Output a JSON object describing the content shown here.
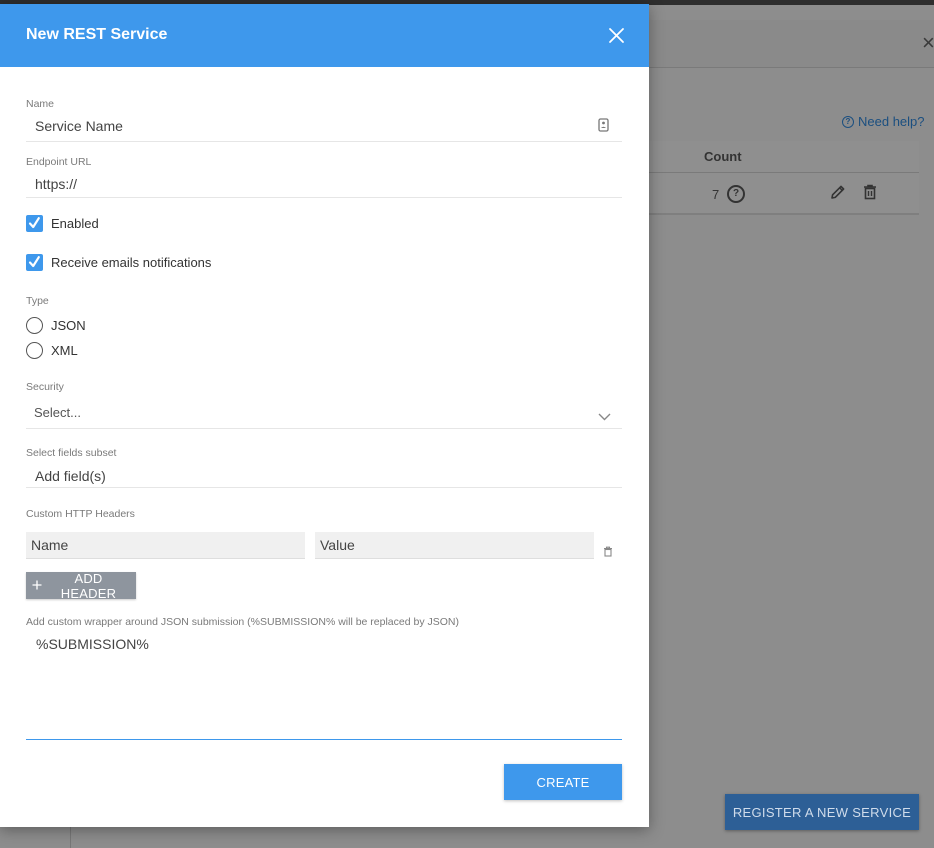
{
  "background": {
    "help_link": "Need help?",
    "table": {
      "count_header": "Count",
      "row": {
        "count": "7"
      }
    },
    "register_button": "REGISTER A NEW SERVICE"
  },
  "modal": {
    "title": "New REST Service",
    "name": {
      "label": "Name",
      "placeholder": "Service Name"
    },
    "endpoint": {
      "label": "Endpoint URL",
      "value": "https://"
    },
    "enabled": {
      "label": "Enabled",
      "checked": true
    },
    "email_notifications": {
      "label": "Receive emails notifications",
      "checked": true
    },
    "type": {
      "label": "Type",
      "options": [
        {
          "label": "JSON",
          "selected": false
        },
        {
          "label": "XML",
          "selected": false
        }
      ]
    },
    "security": {
      "label": "Security",
      "placeholder": "Select..."
    },
    "fields_subset": {
      "label": "Select fields subset",
      "placeholder": "Add field(s)"
    },
    "custom_headers": {
      "label": "Custom HTTP Headers",
      "name_placeholder": "Name",
      "value_placeholder": "Value",
      "add_button": "ADD HEADER"
    },
    "wrapper": {
      "label": "Add custom wrapper around JSON submission (%SUBMISSION% will be replaced by JSON)",
      "value": "%SUBMISSION%"
    },
    "create_button": "CREATE"
  },
  "colors": {
    "accent": "#3e98ec",
    "secondary_button": "#8e959e",
    "register_button": "#2d5f96"
  }
}
